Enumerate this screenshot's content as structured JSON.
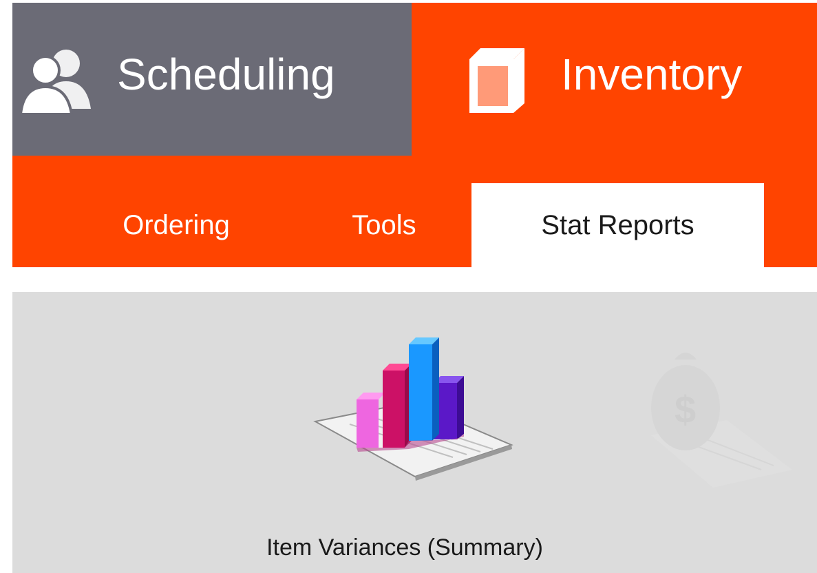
{
  "module_tabs": [
    {
      "label": "Scheduling",
      "icon": "people-icon",
      "active": false
    },
    {
      "label": "Inventory",
      "icon": "box-icon",
      "active": true
    }
  ],
  "sub_tabs": [
    {
      "label": "Ordering",
      "active": false
    },
    {
      "label": "Tools",
      "active": false
    },
    {
      "label": "Stat Reports",
      "active": true
    }
  ],
  "reports": [
    {
      "label": "Item Variances (Summary)",
      "icon": "bar-chart-report-icon"
    },
    {
      "label": "",
      "icon": "money-bag-report-icon"
    }
  ],
  "colors": {
    "brand_orange": "#ff4400",
    "inactive_tab": "#6b6b76",
    "content_bg": "#dcdcdc"
  }
}
